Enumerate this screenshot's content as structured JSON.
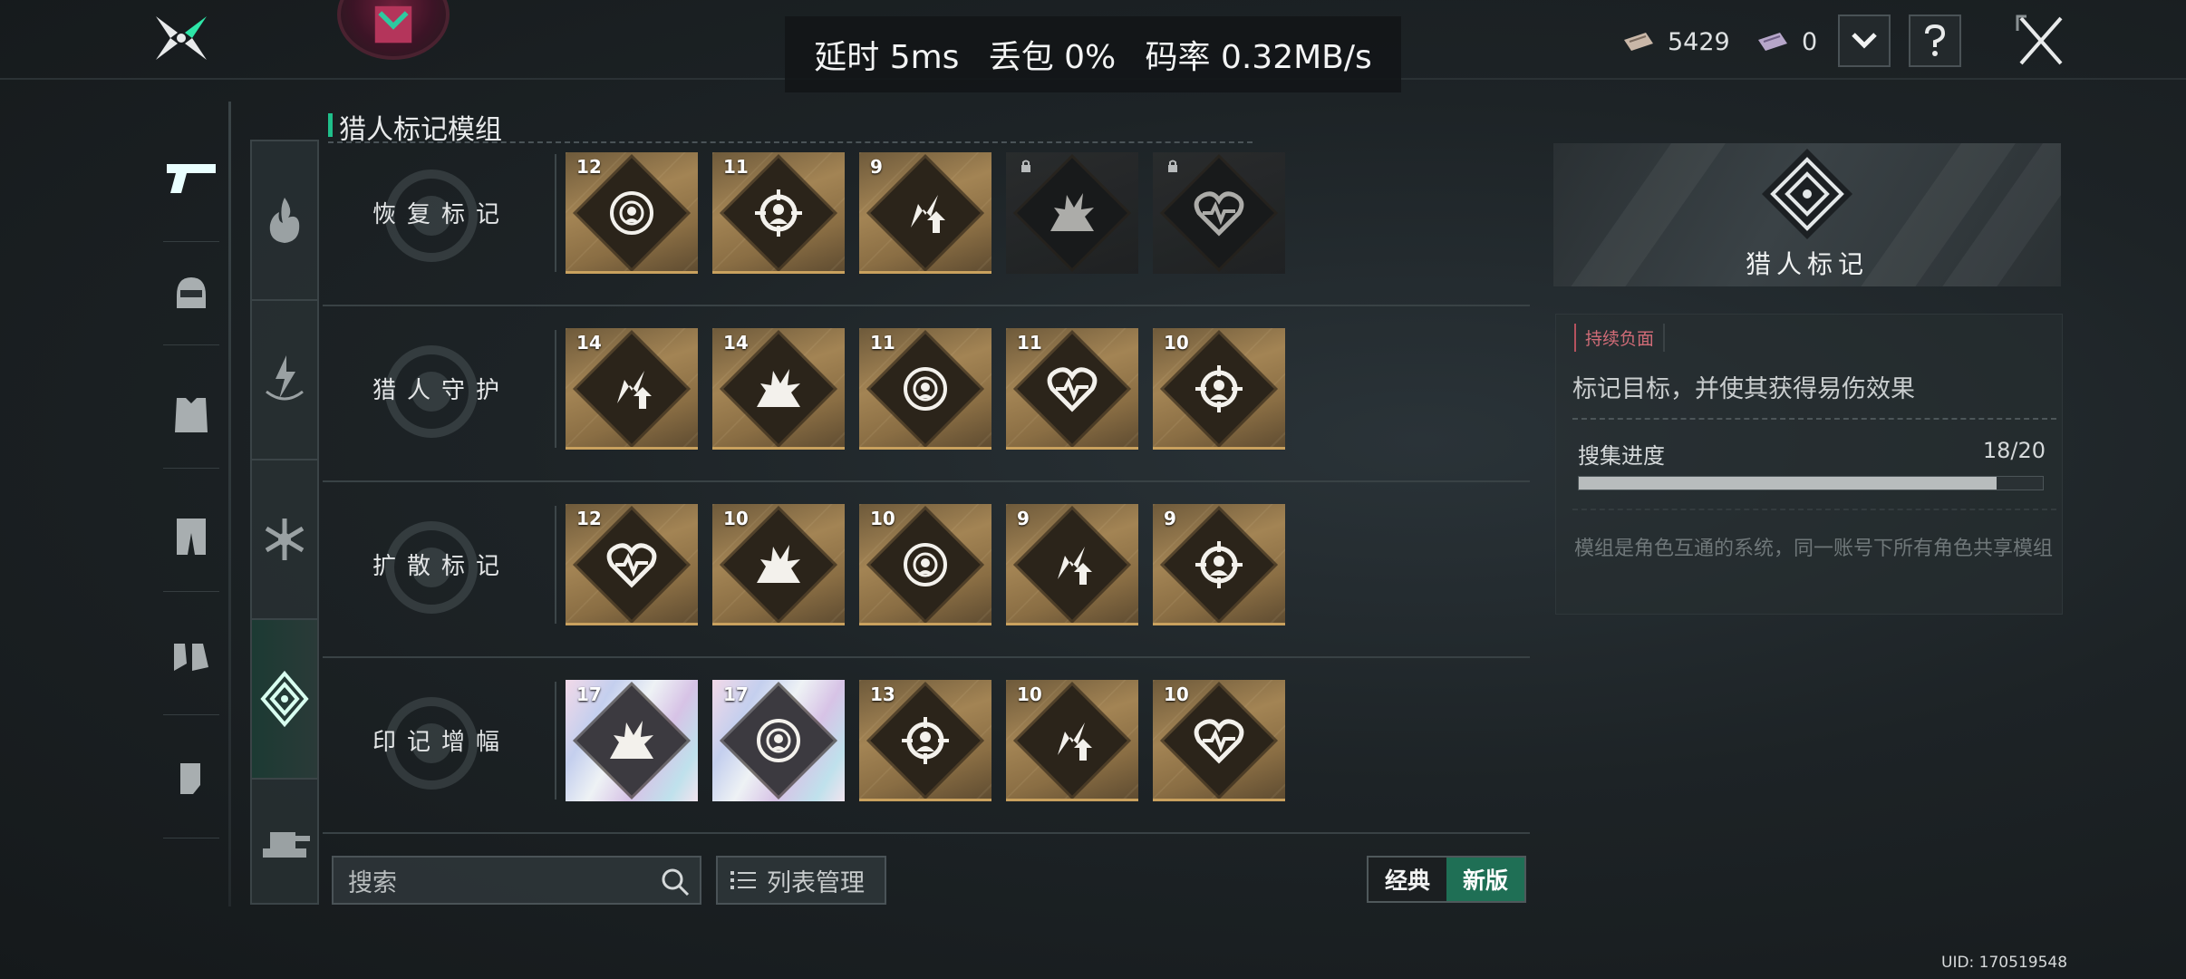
{
  "network": {
    "latency": "延时 5ms",
    "packet_loss": "丢包 0%",
    "bitrate": "码率 0.32MB/s"
  },
  "currency": [
    {
      "icon": "ticket-icon",
      "value": "5429"
    },
    {
      "icon": "ticket-purple-icon",
      "value": "0"
    }
  ],
  "left_nav": [
    "pistol-icon",
    "helmet-icon",
    "armor-vest-icon",
    "pants-icon",
    "boots-icon",
    "gloves-icon"
  ],
  "categories": [
    "fire-icon",
    "lightning-icon",
    "snowflake-icon",
    "hunter-mark-icon",
    "turret-icon"
  ],
  "active_category": 3,
  "section_title": "猎人标记模组",
  "rows": [
    {
      "label": "恢复标记",
      "cards": [
        {
          "num": "12",
          "icon": "target-icon",
          "state": "gold"
        },
        {
          "num": "11",
          "icon": "crosshair-person-icon",
          "state": "gold"
        },
        {
          "num": "9",
          "icon": "lightning-up-icon",
          "state": "gold"
        },
        {
          "num": "",
          "icon": "explosion-icon",
          "state": "locked"
        },
        {
          "num": "",
          "icon": "heart-pulse-icon",
          "state": "locked"
        }
      ]
    },
    {
      "label": "猎人守护",
      "cards": [
        {
          "num": "14",
          "icon": "lightning-up-icon",
          "state": "gold"
        },
        {
          "num": "14",
          "icon": "explosion-icon",
          "state": "gold"
        },
        {
          "num": "11",
          "icon": "target-icon",
          "state": "gold"
        },
        {
          "num": "11",
          "icon": "heart-pulse-icon",
          "state": "gold"
        },
        {
          "num": "10",
          "icon": "crosshair-person-icon",
          "state": "gold"
        }
      ]
    },
    {
      "label": "扩散标记",
      "cards": [
        {
          "num": "12",
          "icon": "heart-pulse-icon",
          "state": "gold"
        },
        {
          "num": "10",
          "icon": "explosion-icon",
          "state": "gold"
        },
        {
          "num": "10",
          "icon": "target-icon",
          "state": "gold"
        },
        {
          "num": "9",
          "icon": "lightning-up-icon",
          "state": "gold"
        },
        {
          "num": "9",
          "icon": "crosshair-person-icon",
          "state": "gold"
        }
      ]
    },
    {
      "label": "印记增幅",
      "cards": [
        {
          "num": "17",
          "icon": "explosion-icon",
          "state": "holo"
        },
        {
          "num": "17",
          "icon": "target-icon",
          "state": "holo"
        },
        {
          "num": "13",
          "icon": "crosshair-person-icon",
          "state": "gold"
        },
        {
          "num": "10",
          "icon": "lightning-up-icon",
          "state": "gold"
        },
        {
          "num": "10",
          "icon": "heart-pulse-icon",
          "state": "gold"
        }
      ]
    }
  ],
  "detail": {
    "title": "猎人标记",
    "tag": "持续负面",
    "description": "标记目标，并使其获得易伤效果",
    "progress_label": "搜集进度",
    "progress_text": "18/20",
    "progress_fraction": 0.9,
    "note": "模组是角色互通的系统，同一账号下所有角色共享模组"
  },
  "search": {
    "placeholder": "搜索"
  },
  "list_manage": "列表管理",
  "toggle": {
    "classic": "经典",
    "new": "新版"
  },
  "uid": "UID: 170519548",
  "colors": {
    "accent": "#1fbf8a",
    "gold": "#c9a15e",
    "tag_red": "#d16c77",
    "toggle_active": "#1f6f55"
  }
}
